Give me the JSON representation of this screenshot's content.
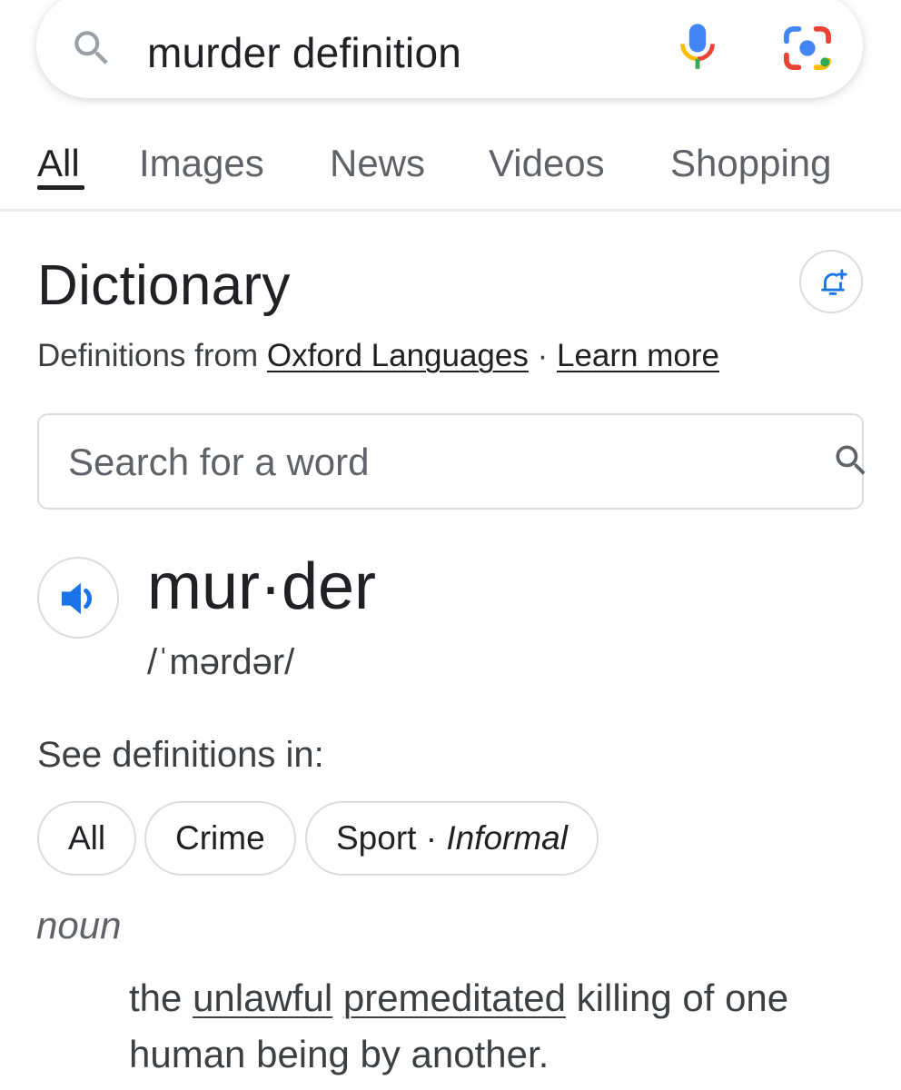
{
  "search": {
    "query": "murder definition",
    "search_icon": "search-icon",
    "mic_icon": "google-mic-icon",
    "lens_icon": "google-lens-icon"
  },
  "tabs": [
    {
      "label": "All",
      "active": true
    },
    {
      "label": "Images",
      "active": false
    },
    {
      "label": "News",
      "active": false
    },
    {
      "label": "Videos",
      "active": false
    },
    {
      "label": "Shopping",
      "active": false
    }
  ],
  "dictionary": {
    "title": "Dictionary",
    "alert_icon": "notification-add-icon",
    "source_prefix": "Definitions from",
    "source_link": "Oxford Languages",
    "separator": "·",
    "learn_more": "Learn more",
    "word_search_placeholder": "Search for a word",
    "headword": "mur·der",
    "phonetic": "/ˈmərdər/",
    "speaker_icon": "volume-icon",
    "see_definitions_label": "See definitions in:",
    "chips": [
      {
        "label": "All",
        "qualifier": ""
      },
      {
        "label": "Crime",
        "qualifier": ""
      },
      {
        "label": "Sport ·",
        "qualifier": "Informal"
      }
    ],
    "part_of_speech": "noun",
    "definition": {
      "text_1": "the",
      "link_1": "unlawful",
      "link_2": "premeditated",
      "text_2": "killing of one human being by another."
    }
  },
  "colors": {
    "google_blue": "#4285F4",
    "google_red": "#EA4335",
    "google_yellow": "#FBBC04",
    "google_green": "#34A853",
    "speaker_blue": "#1a73e8"
  }
}
